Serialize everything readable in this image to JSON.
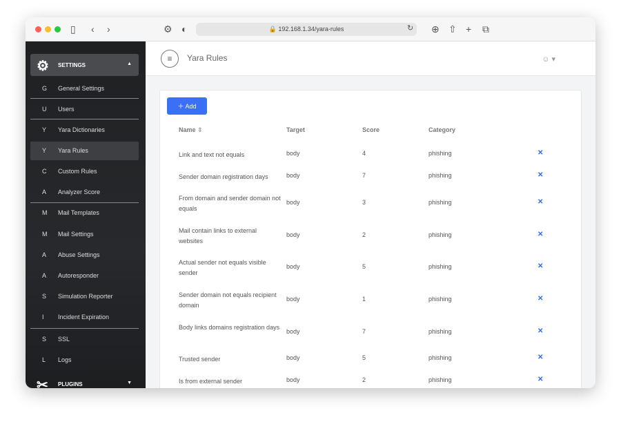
{
  "browser": {
    "url": "192.168.1.34/yara-rules"
  },
  "sidebar": {
    "settings_label": "SETTINGS",
    "plugins_label": "PLUGINS",
    "items": [
      {
        "letter": "G",
        "label": "General Settings"
      },
      {
        "letter": "U",
        "label": "Users"
      },
      {
        "letter": "Y",
        "label": "Yara Dictionaries"
      },
      {
        "letter": "Y",
        "label": "Yara Rules",
        "active": true
      },
      {
        "letter": "C",
        "label": "Custom Rules"
      },
      {
        "letter": "A",
        "label": "Analyzer Score"
      },
      {
        "letter": "M",
        "label": "Mail Templates"
      },
      {
        "letter": "M",
        "label": "Mail Settings"
      },
      {
        "letter": "A",
        "label": "Abuse Settings"
      },
      {
        "letter": "A",
        "label": "Autoresponder"
      },
      {
        "letter": "S",
        "label": "Simulation Reporter"
      },
      {
        "letter": "I",
        "label": "Incident Expiration"
      },
      {
        "letter": "S",
        "label": "SSL"
      },
      {
        "letter": "L",
        "label": "Logs"
      }
    ]
  },
  "header": {
    "title": "Yara Rules"
  },
  "toolbar": {
    "add_label": "Add"
  },
  "table": {
    "columns": [
      "Name",
      "Target",
      "Score",
      "Category"
    ],
    "rows": [
      {
        "name": "Link and text not equals",
        "target": "body",
        "score": "4",
        "category": "phishing"
      },
      {
        "name": "Sender domain registration days",
        "target": "body",
        "score": "7",
        "category": "phishing"
      },
      {
        "name": "From domain and sender domain not equals",
        "target": "body",
        "score": "3",
        "category": "phishing"
      },
      {
        "name": "Mail contain links to external websites",
        "target": "body",
        "score": "2",
        "category": "phishing"
      },
      {
        "name": "Actual sender not equals visible sender",
        "target": "body",
        "score": "5",
        "category": "phishing"
      },
      {
        "name": "Sender domain not equals recipient domain",
        "target": "body",
        "score": "1",
        "category": "phishing"
      },
      {
        "name": "Body links domains registration days",
        "target": "body",
        "score": "7",
        "category": "phishing"
      },
      {
        "name": "Trusted sender",
        "target": "body",
        "score": "5",
        "category": "phishing"
      },
      {
        "name": "Is from external sender",
        "target": "body",
        "score": "2",
        "category": "phishing"
      }
    ]
  },
  "colors": {
    "accent": "#3b6ff5",
    "delete": "#2f6bf0",
    "sidebar": "#222326"
  }
}
